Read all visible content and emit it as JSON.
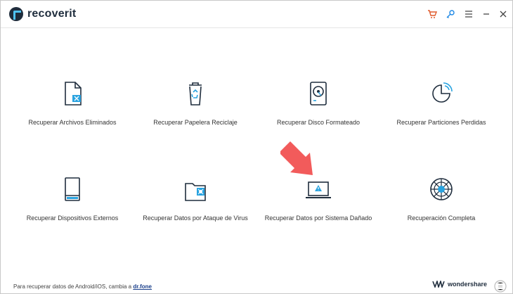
{
  "app": {
    "logo_text": "recoverit"
  },
  "toolbar": {
    "icons": [
      "cart-icon",
      "key-icon",
      "menu-icon",
      "minimize-icon",
      "close-icon"
    ],
    "accent_cart": "#e05a2b",
    "accent_key": "#1e88e5"
  },
  "options": [
    {
      "label": "Recuperar Archivos Eliminados",
      "icon": "deleted-file-icon"
    },
    {
      "label": "Recuperar Papelera Reciclaje",
      "icon": "recycle-bin-icon"
    },
    {
      "label": "Recuperar Disco Formateado",
      "icon": "hard-drive-icon"
    },
    {
      "label": "Recuperar Particiones Perdidas",
      "icon": "partition-icon"
    },
    {
      "label": "Recuperar Dispositivos Externos",
      "icon": "external-device-icon"
    },
    {
      "label": "Recuperar Datos por Ataque de Virus",
      "icon": "virus-folder-icon"
    },
    {
      "label": "Recuperar Datos por Sistema Dañado",
      "icon": "crashed-system-icon"
    },
    {
      "label": "Recuperación Completa",
      "icon": "complete-recovery-icon"
    }
  ],
  "footer": {
    "text": "Para recuperar datos de Android/iOS, cambia a ",
    "link": "dr.fone"
  },
  "brand": {
    "name": "wondershare"
  },
  "colors": {
    "icon_dark": "#1f2d3d",
    "icon_accent": "#29a3e0",
    "arrow": "#f25b5b"
  }
}
